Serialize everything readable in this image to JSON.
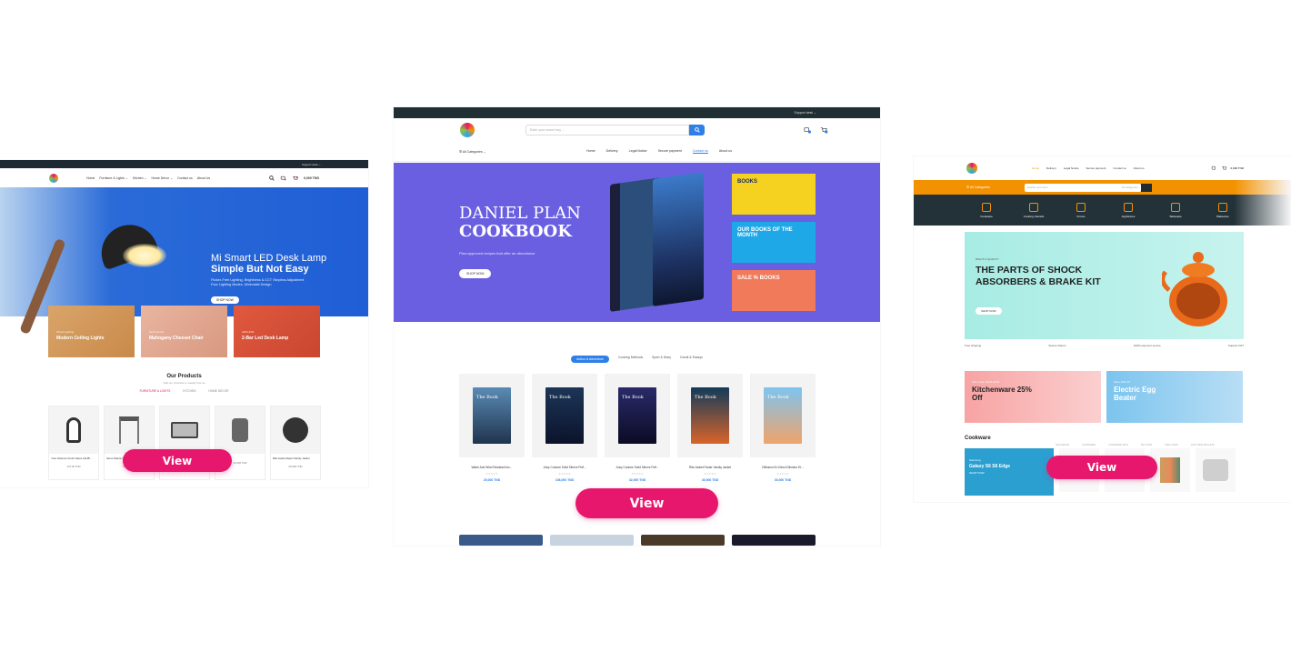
{
  "view_label": "View",
  "preview_lamp": {
    "topbar": "Support desk ⌄",
    "nav": [
      "Home",
      "Furniture & Lights ⌄",
      "Kitchen ⌄",
      "Home Décor ⌄",
      "Contact us",
      "About Us"
    ],
    "cart_total": "0,000 TND",
    "hero": {
      "line1": "Mi Smart LED Desk Lamp",
      "line2": "Simple But Not Easy",
      "sub": "Flicker-Free Lighting, Brightness & CCT Stepless Adjustment Four Lighting Modes, Minimalist Design",
      "button": "SHOP NOW"
    },
    "categories": [
      {
        "small": "Wood Lighting",
        "title": "Modern Ceiling Lights"
      },
      {
        "small": "New Trends",
        "title": "Mahogany Chesset Chair"
      },
      {
        "small": "ARCHIVE",
        "title": "2-Bar Led Desk Lamp"
      }
    ],
    "section_title": "Our Products",
    "section_sub": "Add our products to weekly line up",
    "tabs": [
      "FURNITURE & LIGHTS",
      "KITCHEN",
      "HOME DECOR"
    ],
    "products": [
      {
        "name": "Yves Solomon Fresh Vases LALIB...",
        "price": "137,00 TND"
      },
      {
        "name": "Serve Nature Stool",
        "price": "71,000 TND"
      },
      {
        "name": "Bench",
        "price": ""
      },
      {
        "name": "",
        "price": "20,000 TND"
      },
      {
        "name": "Rita Jacket Reject Varsity Jacket",
        "price": "50,000 TND"
      }
    ]
  },
  "preview_books": {
    "topbar": "Support desk ⌄",
    "search_placeholder": "Enter your search key ...",
    "all_categories": "All Categories",
    "menu": [
      "Home",
      "Delivery",
      "Legal Notice",
      "Secure payment",
      "Contact us",
      "About us"
    ],
    "hero": {
      "line1": "DANIEL PLAN",
      "line2": "COOKBOOK",
      "sub": "Plan-approved recipes that offer an abundance",
      "button": "SHOP NOW"
    },
    "promos": [
      {
        "text": "BOOKS"
      },
      {
        "text": "OUR BOOKS OF THE MONTH"
      },
      {
        "text": "SALE % BOOKS"
      }
    ],
    "cat_tabs": [
      "Action & Adventure",
      "Cooking Methods",
      "Sport & Diary",
      "Gondi & Essays"
    ],
    "books": [
      {
        "title": "The Book",
        "name": "Water And Wind Resistant Ins...",
        "price": "20,000 TND"
      },
      {
        "title": "The Book",
        "name": "Juicy Couture Solid Sleeve Puff...",
        "price": "108,000 TND"
      },
      {
        "title": "The Book",
        "name": "Juicy Couture Solid Sleeve Puff...",
        "price": "32,000 TND"
      },
      {
        "title": "The Book",
        "name": "Rita Jacket Faster Varsity Jacket",
        "price": "40,000 TND"
      },
      {
        "title": "The Book",
        "name": "Diffusion En Direct Dilmieur Et...",
        "price": "30,000 TND"
      }
    ]
  },
  "preview_kitchen": {
    "menu": [
      "Home",
      "Delivery",
      "Legal Notice",
      "Secure payment",
      "Contact us",
      "About us"
    ],
    "cart_total": "0,000 TND",
    "all_categories": "All Categories",
    "search_placeholder": "Search your item",
    "category_select": "All categories",
    "cats": [
      "Cookware",
      "Cooking Utensils",
      "Knives",
      "Appliances",
      "Tableware",
      "Bakeware"
    ],
    "hero": {
      "small": "RIGHT & QUALITY",
      "title": "THE PARTS OF SHOCK ABSORBERS & BRAKE KIT",
      "button": "SHOP NOW"
    },
    "features": [
      "Free shipping",
      "Secure Return",
      "100% payment secure",
      "Support 24/7"
    ],
    "banners": [
      {
        "small": "Use Code: ECOLATE?",
        "title": "Kitchenware 25% Off"
      },
      {
        "small": "Save 40% Of",
        "title": "Electric Egg Beater"
      }
    ],
    "cookware_title": "Cookware",
    "cookware_tabs": [
      "SAUCEPANS",
      "COOKWARE",
      "COOKWARE SETS",
      "FRY PANS",
      "GRILL PANS",
      "CAST IRON SKILLETS"
    ],
    "galaxy": {
      "small": "Samsung",
      "title": "Galaxy S6 S6 Edge",
      "button": "SHOP NOW"
    }
  }
}
